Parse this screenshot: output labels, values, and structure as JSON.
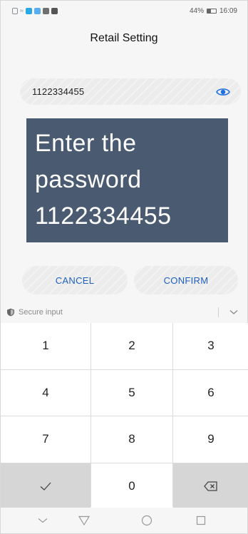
{
  "status_bar": {
    "battery_percent": "44%",
    "battery_level": 0.44,
    "time": "16:09",
    "app_icon_colors": [
      "#9aa3ad",
      "#9aa3ad",
      "#2aa8e6",
      "#5aaef0",
      "#6f6f6f",
      "#555555"
    ]
  },
  "header": {
    "title": "Retail Setting"
  },
  "password_field": {
    "value": "1122334455"
  },
  "overlay": {
    "lines": [
      "Enter the",
      "password",
      "1122334455"
    ],
    "background": "#4a5b71"
  },
  "buttons": {
    "cancel": "CANCEL",
    "confirm": "CONFIRM",
    "accent": "#1f5fbf"
  },
  "keyboard": {
    "secure_label": "Secure input",
    "keys": [
      "1",
      "2",
      "3",
      "4",
      "5",
      "6",
      "7",
      "8",
      "9",
      "✓",
      "0",
      "⌫"
    ]
  },
  "nav_bar": {
    "icons": [
      "hide-keyboard-icon",
      "back-icon",
      "home-icon",
      "recents-icon"
    ]
  }
}
